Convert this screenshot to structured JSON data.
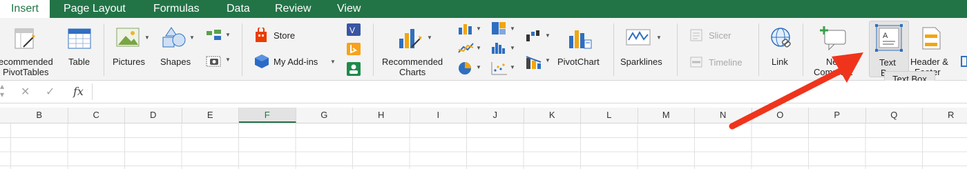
{
  "tabs": [
    {
      "label": "Insert",
      "active": true
    },
    {
      "label": "Page Layout"
    },
    {
      "label": "Formulas"
    },
    {
      "label": "Data"
    },
    {
      "label": "Review"
    },
    {
      "label": "View"
    }
  ],
  "ribbon": {
    "recommended_pivot_1": "ecommended",
    "recommended_pivot_2": "PivotTables",
    "table": "Table",
    "pictures": "Pictures",
    "shapes": "Shapes",
    "store": "Store",
    "my_addins": "My Add-ins",
    "rec_charts_1": "Recommended",
    "rec_charts_2": "Charts",
    "pivotchart": "PivotChart",
    "sparklines": "Sparklines",
    "slicer": "Slicer",
    "timeline": "Timeline",
    "link": "Link",
    "new_comment_1": "New",
    "new_comment_2": "Comment",
    "text_box_1": "Text",
    "text_box_2": "Box",
    "header_footer_1": "Header &",
    "header_footer_2": "Footer"
  },
  "tooltip": "Text Box",
  "formula_bar": {
    "fx": "fx"
  },
  "columns": [
    "B",
    "C",
    "D",
    "E",
    "F",
    "G",
    "H",
    "I",
    "J",
    "K",
    "L",
    "M",
    "N",
    "O",
    "P",
    "Q",
    "R"
  ],
  "selected_column": "F",
  "colors": {
    "accent": "#227447",
    "arrow": "#f0341c"
  }
}
